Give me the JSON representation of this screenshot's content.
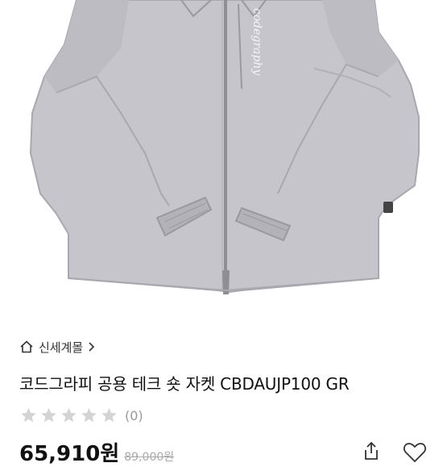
{
  "breadcrumb": {
    "icon": "home-icon",
    "label": "신세계몰",
    "chevron": "chevron-right-icon"
  },
  "product": {
    "title": "코드그라피 공용 테크 숏 자켓 CBDAUJP100 GR",
    "image": "gray-hooded-tech-jacket",
    "chest_print": "codegraphy"
  },
  "rating": {
    "stars_filled": 0,
    "stars_total": 5,
    "count_label": "(0)"
  },
  "price": {
    "current": "65,910원",
    "original": "89,000원"
  },
  "actions": {
    "share_icon": "share-icon",
    "wish_icon": "heart-icon"
  },
  "colors": {
    "jacket": "#c4c3c9",
    "jacket_shadow": "#a9a8ae",
    "star_empty": "#d4d4d4"
  }
}
